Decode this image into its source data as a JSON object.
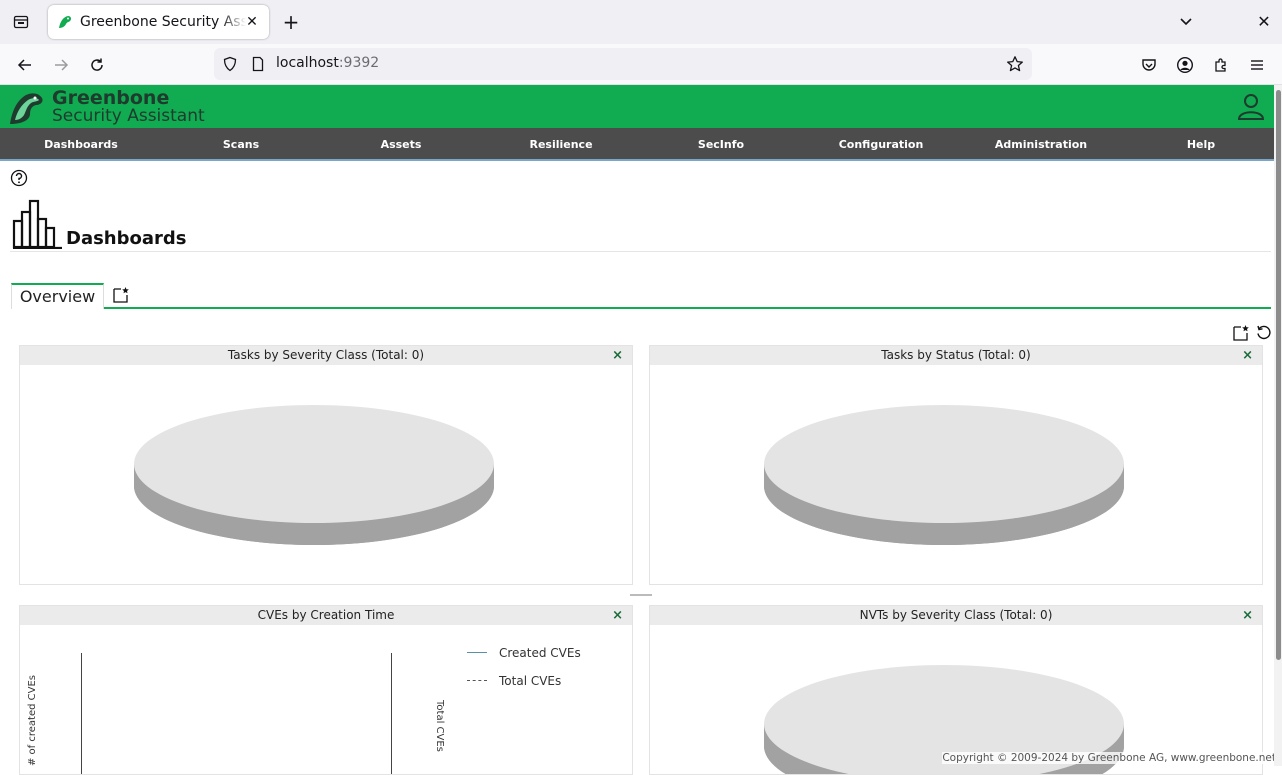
{
  "browser": {
    "tab_title": "Greenbone Security Assistant",
    "url_host": "localhost",
    "url_port": ":9392"
  },
  "app": {
    "logo_line1": "Greenbone",
    "logo_line2": "Security Assistant",
    "brand_color": "#11ab51",
    "menu": [
      "Dashboards",
      "Scans",
      "Assets",
      "Resilience",
      "SecInfo",
      "Configuration",
      "Administration",
      "Help"
    ]
  },
  "page": {
    "title": "Dashboards",
    "tabs": [
      "Overview"
    ]
  },
  "panels": [
    {
      "title": "Tasks by Severity Class (Total: 0)",
      "close": "×"
    },
    {
      "title": "Tasks by Status (Total: 0)",
      "close": "×"
    },
    {
      "title": "CVEs by Creation Time",
      "close": "×",
      "legend": [
        "Created CVEs",
        "Total CVEs"
      ],
      "y_left_label": "# of created CVEs",
      "y_right_label": "Total CVEs"
    },
    {
      "title": "NVTs by Severity Class (Total: 0)",
      "close": "×"
    }
  ],
  "footer": {
    "copyright": "Copyright © 2009-2024 by Greenbone AG, www.greenbone.net"
  }
}
